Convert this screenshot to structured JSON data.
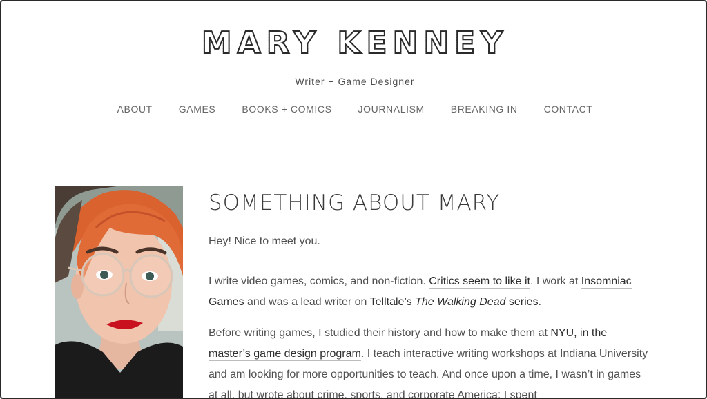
{
  "header": {
    "site_title": "MARY KENNEY",
    "tagline": "Writer + Game Designer"
  },
  "nav": {
    "items": [
      "ABOUT",
      "GAMES",
      "BOOKS + COMICS",
      "JOURNALISM",
      "BREAKING IN",
      "CONTACT"
    ]
  },
  "main": {
    "heading": "SOMETHING ABOUT MARY",
    "greeting": "Hey! Nice to meet you.",
    "para1": {
      "t1": "I write video games, comics, and non-fiction. ",
      "link_critics": "Critics seem to like it",
      "t2": ". I work at ",
      "link_insomniac": "Insomniac Games",
      "t3": " and was a lead writer on ",
      "link_telltale_prefix": "Telltale’s ",
      "link_telltale_title": "The Walking Dead",
      "link_telltale_suffix": " series",
      "t4": "."
    },
    "para2": {
      "t1": "Before writing games, I studied their history and how to make them at ",
      "link_nyu": "NYU, in the master’s game design program",
      "t2": ". I teach interactive writing workshops at Indiana University and am looking for more opportunities to teach. And once upon a time, I wasn’t in games at all, but wrote about crime, sports, and corporate America; I spent"
    }
  },
  "colors": {
    "text": "#505050",
    "heading": "#3a3a3a",
    "link": "#2e2e2e",
    "nav": "#666666",
    "hair": "#e0693a",
    "lips": "#c8101e"
  }
}
